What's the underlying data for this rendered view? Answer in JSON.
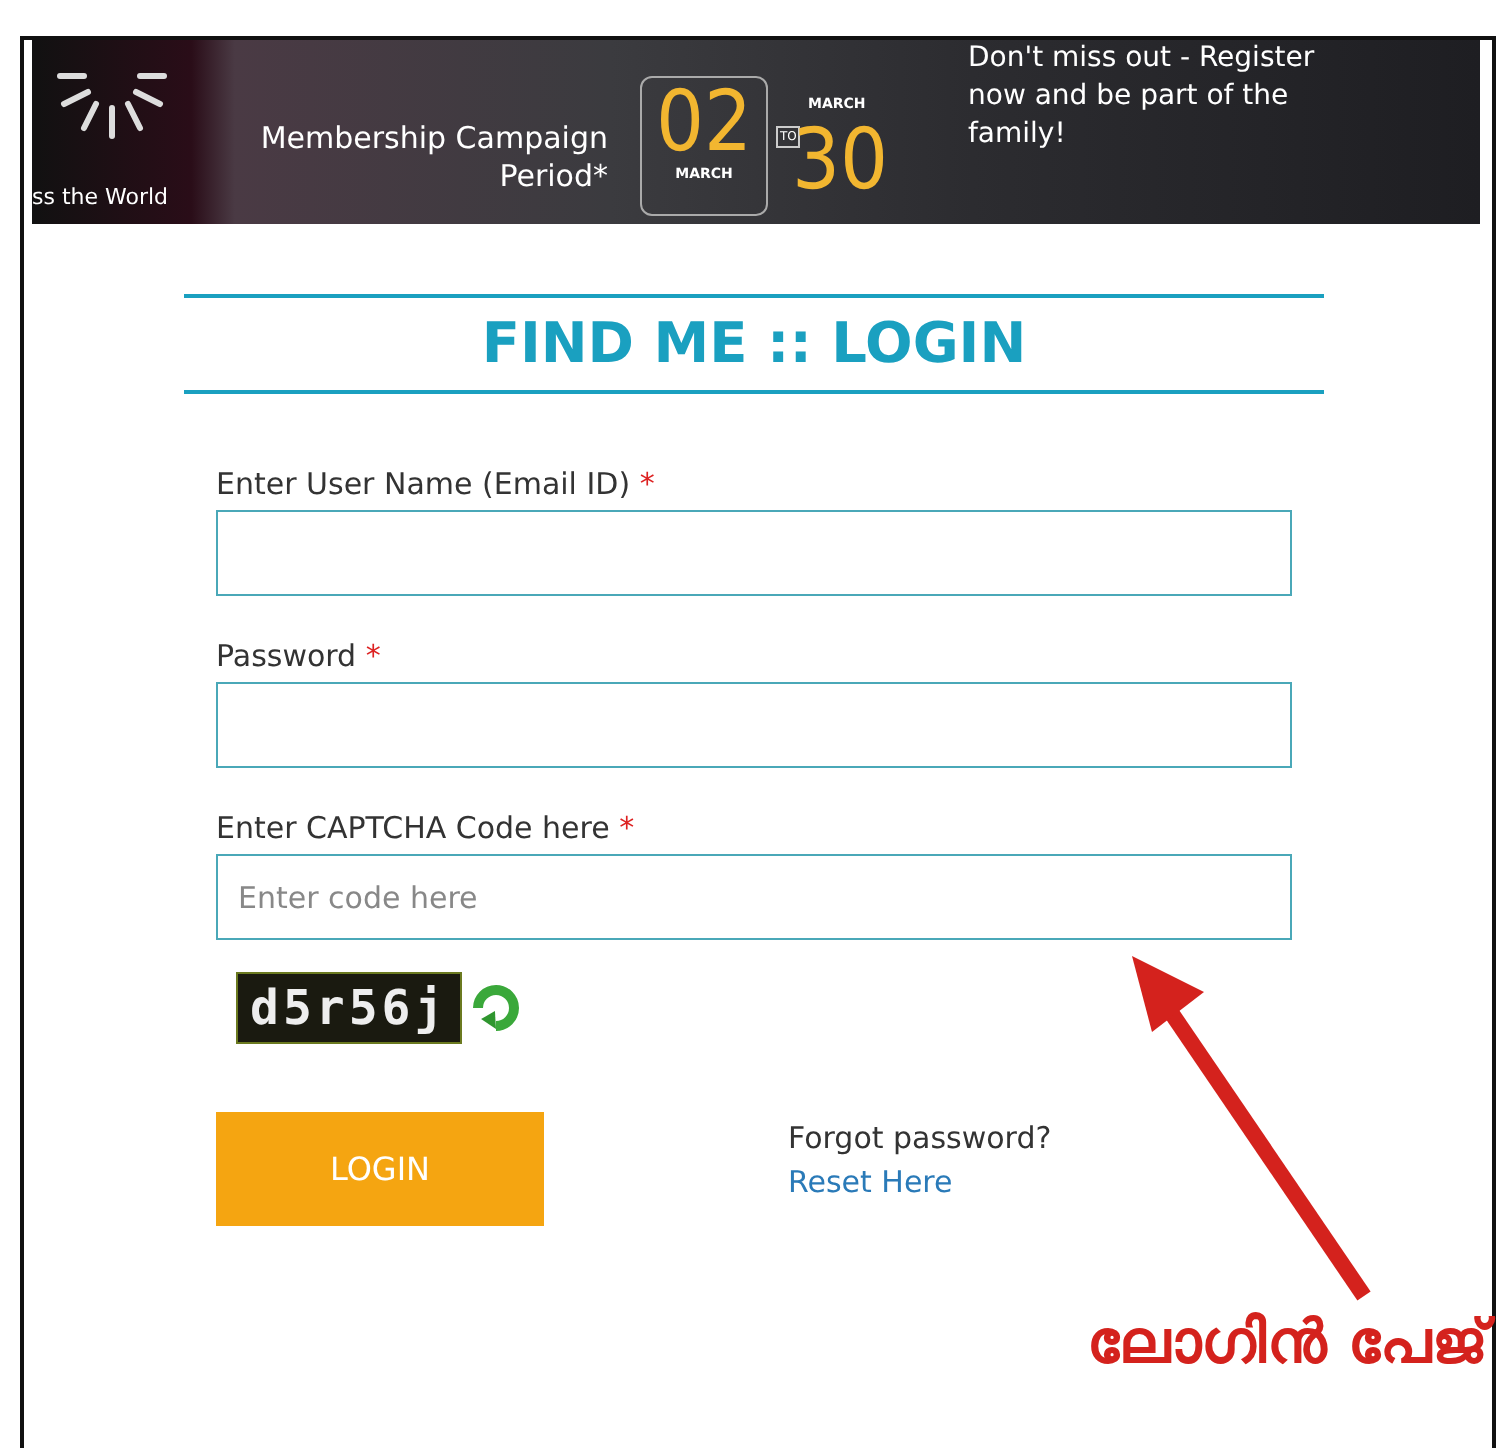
{
  "banner": {
    "left_caption": "ss the World",
    "campaign_label": "Membership Campaign Period*",
    "start_day": "02",
    "start_month": "MARCH",
    "to_label": "TO",
    "end_month": "MARCH",
    "end_day": "30",
    "promo_text": "Don't miss out - Register now and be part of the family!"
  },
  "form": {
    "title": "FIND ME :: LOGIN",
    "fields": [
      {
        "label": "Enter User Name (Email ID)",
        "required_mark": "*"
      },
      {
        "label": "Password",
        "required_mark": "*"
      },
      {
        "label": "Enter CAPTCHA Code here",
        "required_mark": "*",
        "placeholder": "Enter code here"
      }
    ],
    "captcha": {
      "code": "d5r56j"
    },
    "login_button": "LOGIN",
    "forgot_text": "Forgot password?",
    "reset_link": "Reset Here"
  },
  "annotation": {
    "label": "ലോഗിൻ പേജ്"
  }
}
